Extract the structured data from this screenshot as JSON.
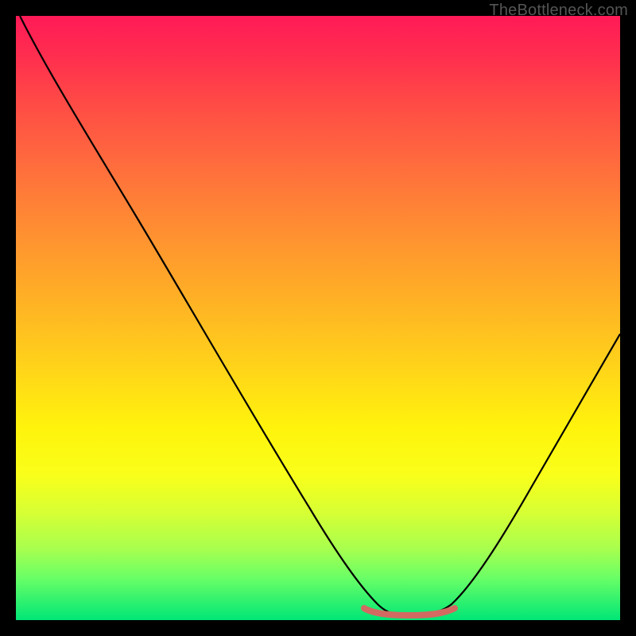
{
  "watermark": {
    "text": "TheBottleneck.com"
  },
  "colors": {
    "curve": "#000000",
    "marker": "#d26a62",
    "frame": "#000000"
  },
  "chart_data": {
    "type": "line",
    "title": "",
    "xlabel": "",
    "ylabel": "",
    "xlim": [
      0,
      100
    ],
    "ylim": [
      0,
      100
    ],
    "grid": false,
    "legend": false,
    "comment": "V-shaped bottleneck curve: falls from top-left to a broad flat minimum around x≈55–70, then rises toward upper-right. Short coral marker segment sits at the bottom of the valley. Axes are unlabeled; values are relative percentages read off the plot frame.",
    "series": [
      {
        "name": "bottleneck_curve",
        "color": "#000000",
        "x": [
          0,
          5,
          10,
          15,
          20,
          25,
          30,
          35,
          40,
          45,
          50,
          55,
          58,
          62,
          66,
          70,
          72,
          75,
          80,
          85,
          90,
          95,
          100
        ],
        "values": [
          100,
          92,
          84,
          76,
          68,
          59,
          50,
          41,
          32,
          23,
          14,
          6,
          2,
          1,
          1,
          2,
          4,
          9,
          18,
          28,
          38,
          49,
          60
        ]
      },
      {
        "name": "optimal_marker",
        "color": "#d26a62",
        "x": [
          55,
          58,
          60,
          62,
          64,
          66,
          68,
          70
        ],
        "values": [
          3,
          2,
          1.5,
          1.2,
          1.2,
          1.5,
          2,
          3
        ]
      }
    ]
  }
}
